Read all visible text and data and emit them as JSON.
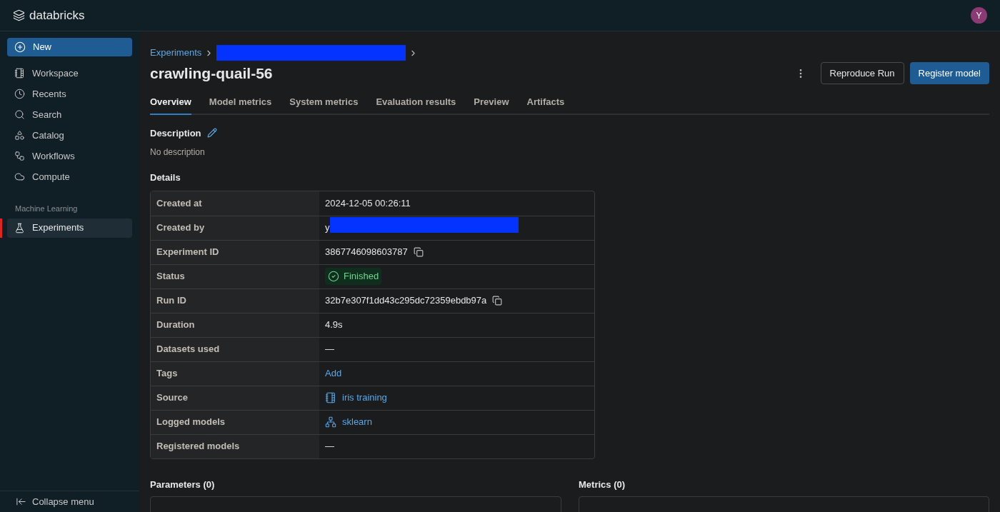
{
  "topbar": {
    "logo": "databricks",
    "avatar": "Y"
  },
  "sidebar": {
    "new_button": "New",
    "items": [
      {
        "label": "Workspace",
        "selected": false
      },
      {
        "label": "Recents",
        "selected": false
      },
      {
        "label": "Search",
        "selected": false
      },
      {
        "label": "Catalog",
        "selected": false
      },
      {
        "label": "Workflows",
        "selected": false
      },
      {
        "label": "Compute",
        "selected": false
      }
    ],
    "section": "Machine Learning",
    "section_items": [
      {
        "label": "Experiments",
        "selected": true
      }
    ],
    "collapse": "Collapse menu"
  },
  "breadcrumb": {
    "link": "Experiments"
  },
  "title": "crawling-quail-56",
  "actions": [
    "Reproduce Run",
    "Register model"
  ],
  "tabs": [
    {
      "label": "Overview",
      "selected": true
    },
    {
      "label": "Model metrics",
      "selected": false
    },
    {
      "label": "System metrics",
      "selected": false
    },
    {
      "label": "Evaluation results",
      "selected": false
    },
    {
      "label": "Preview",
      "selected": false
    },
    {
      "label": "Artifacts",
      "selected": false
    }
  ],
  "description": {
    "heading": "Description",
    "text": "No description"
  },
  "details": {
    "heading": "Details",
    "rows": [
      {
        "label": "Created at",
        "kind": "text",
        "value": "2024-12-05 00:26:11"
      },
      {
        "label": "Created by",
        "kind": "redacted",
        "value": "y"
      },
      {
        "label": "Experiment ID",
        "kind": "copy",
        "value": "3867746098603787"
      },
      {
        "label": "Status",
        "kind": "status",
        "value": "Finished"
      },
      {
        "label": "Run ID",
        "kind": "copy",
        "value": "32b7e307f1dd43c295dc72359ebdb97a"
      },
      {
        "label": "Duration",
        "kind": "text",
        "value": "4.9s"
      },
      {
        "label": "Datasets used",
        "kind": "text",
        "value": "—"
      },
      {
        "label": "Tags",
        "kind": "link",
        "value": "Add"
      },
      {
        "label": "Source",
        "kind": "notebook",
        "value": "iris training"
      },
      {
        "label": "Logged models",
        "kind": "model",
        "value": "sklearn"
      },
      {
        "label": "Registered models",
        "kind": "text",
        "value": "—"
      }
    ]
  },
  "parameters": {
    "heading": "Parameters (0)"
  },
  "metrics": {
    "heading": "Metrics (0)"
  }
}
